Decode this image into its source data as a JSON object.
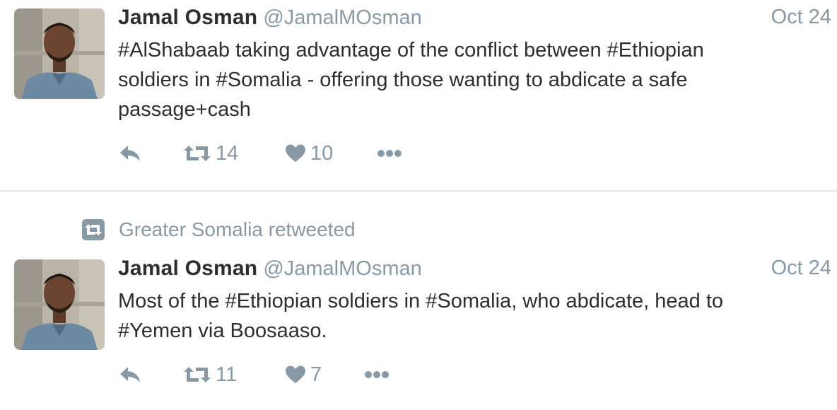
{
  "tweets": [
    {
      "author_name": "Jamal Osman",
      "author_handle": "@JamalMOsman",
      "date": "Oct 24",
      "text_lines": [
        "#AlShabaab taking advantage of the conflict between #Ethiopian",
        "soldiers in #Somalia - offering those wanting to abdicate a safe",
        "passage+cash"
      ],
      "retweet_count": "14",
      "like_count": "10"
    },
    {
      "retweeted_by": "Greater Somalia retweeted",
      "author_name": "Jamal Osman",
      "author_handle": "@JamalMOsman",
      "date": "Oct 24",
      "text_lines": [
        "Most of the #Ethiopian soldiers in #Somalia, who abdicate, head to",
        "#Yemen via Boosaaso."
      ],
      "retweet_count": "11",
      "like_count": "7"
    }
  ],
  "icons": {
    "reply": "reply-icon",
    "retweet": "retweet-icon",
    "like": "heart-icon",
    "more": "more-dots-icon",
    "retweeted_indicator": "retweet-badge-icon"
  },
  "colors": {
    "icon_gray": "#8899a6",
    "text": "#292f33",
    "divider": "#e1e8ed"
  }
}
